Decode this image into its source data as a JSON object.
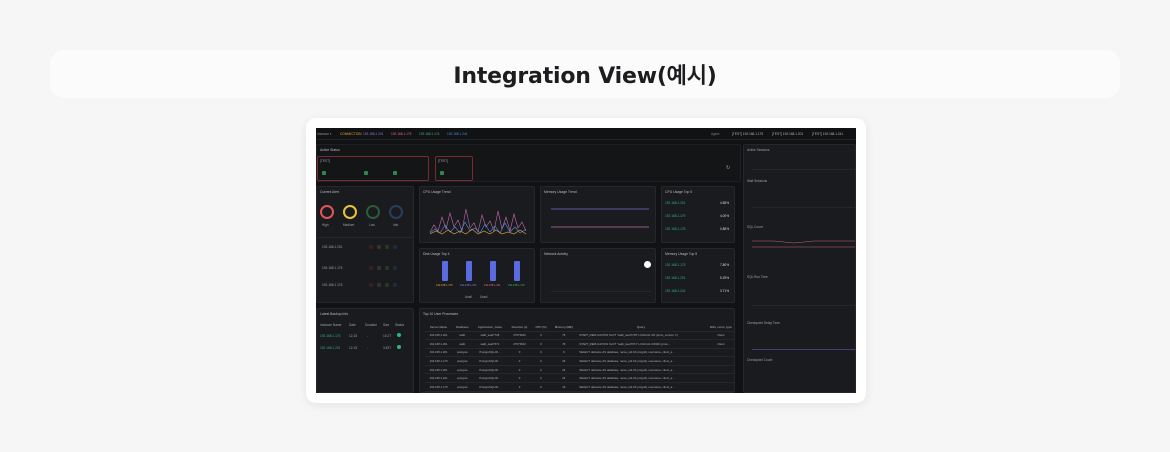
{
  "page": {
    "title": "Integration View(예시)"
  },
  "dash": {
    "topbar": {
      "instance_label": "Instance ▾",
      "tags": [
        "CONNECTION",
        "192.168.1.201",
        "192.168.1.175",
        "192.168.1.176",
        "192.168.1.241"
      ],
      "agent_label": "Agent",
      "agents": [
        "[TEST] 192.168.1.175",
        "[TEST] 192.168.1.201",
        "[TEST] 192.168.1.241"
      ],
      "colors": [
        "#e8a33b",
        "#8a7de0",
        "#e06a8a",
        "#45b36b",
        "#4a8fe0"
      ]
    },
    "active_status": {
      "title": "Active Status",
      "group_a": "[TEST]",
      "group_b": "[TEST]"
    },
    "alert": {
      "title": "Current Alert",
      "levels": [
        {
          "label": "High",
          "value": "1",
          "color": "#e05555"
        },
        {
          "label": "Medium",
          "value": "1",
          "color": "#e8c23b"
        },
        {
          "label": "Low",
          "value": "0",
          "color": "#3aa864"
        },
        {
          "label": "Info",
          "value": "0",
          "color": "#4a8fe0"
        }
      ],
      "hosts": [
        "192.168.1.201",
        "192.168.1.175",
        "192.168.1.176"
      ]
    },
    "cpu_trend": {
      "title": "CPU Usage Trend"
    },
    "mem_trend": {
      "title": "Memory Usage Trend"
    },
    "cpu_top": {
      "title": "CPU Usage Top 5",
      "rows": [
        {
          "host": "192.168.1.201",
          "value": "4.58%",
          "pct": 0.05
        },
        {
          "host": "192.168.1.175",
          "value": "4.00%",
          "pct": 0.04
        },
        {
          "host": "192.168.1.176",
          "value": "0.88%",
          "pct": 0.01
        }
      ]
    },
    "mem_top": {
      "title": "Memory Usage Top 5",
      "rows": [
        {
          "host": "192.168.1.175",
          "value": "7.80%",
          "pct": 0.08
        },
        {
          "host": "192.168.1.201",
          "value": "5.29%",
          "pct": 0.05
        },
        {
          "host": "192.168.1.241",
          "value": "3.71%",
          "pct": 0.04
        }
      ]
    },
    "disk_top": {
      "title": "Disk Usage Top 4",
      "hosts": [
        "192.168.1.175",
        "192.168.1.201",
        "192.168.1.241",
        "192.168.1.176"
      ],
      "legend": [
        "Avail",
        "Used"
      ]
    },
    "network": {
      "title": "Network Activity"
    },
    "backup": {
      "title": "Latest Backup Info",
      "headers": [
        "Instance Name",
        "Date",
        "Duration",
        "Size",
        "Status"
      ],
      "rows": [
        [
          "192.168.1.175",
          "12-15",
          "-",
          "15.2T"
        ],
        [
          "192.168.1.201",
          "12-15",
          "-",
          "3.52T"
        ]
      ]
    },
    "processes": {
      "title": "Top 10 User Processes",
      "headers": [
        "Server Name",
        "Database",
        "Application_name",
        "Duration (s)",
        "CPU (%)",
        "Memory (MB)",
        "Query",
        "Wait_event_type"
      ],
      "rows": [
        [
          "192.168.1.201",
          "walb",
          "walb_lead7728",
          "27673623",
          "0",
          "76",
          "START_REPLICATION SLOT \"walb_lead7728\" LOGICAL 0/0 (proto_version '1')",
          "Client"
        ],
        [
          "192.168.1.201",
          "walb",
          "walb_lead7671",
          "27673623",
          "0",
          "76",
          "START_REPLICATION SLOT \"walb_lead7671\" LOGICAL 0/4900 (proto...",
          "Client"
        ],
        [
          "192.168.1.201",
          "postgres",
          "PostgreSQLJD...",
          "0",
          "0",
          "0",
          "SELECT datname AS database, name, pid AS pro(pid), username, client_a...",
          ""
        ],
        [
          "192.168.1.175",
          "postgres",
          "PostgreSQLJD...",
          "0",
          "0",
          "26",
          "SELECT datname AS database, name, pid AS pro(pid), username, client_a...",
          ""
        ],
        [
          "192.168.1.201",
          "postgres",
          "PostgreSQLJD...",
          "0",
          "0",
          "24",
          "SELECT datname AS database, name, pid AS pro(pid), username, client_a...",
          ""
        ],
        [
          "192.168.1.241",
          "postgres",
          "PostgreSQLJD...",
          "0",
          "0",
          "24",
          "SELECT datname AS database, name, pid AS pro(pid), username, client_a...",
          ""
        ],
        [
          "192.168.1.175",
          "postgres",
          "PostgreSQLJD...",
          "0",
          "0",
          "16",
          "SELECT datname AS database, name, pid AS pro(pid), username, client_a...",
          ""
        ],
        [
          "192.168.1.201",
          "postgres",
          "PostgreSQLJD...",
          "0",
          "0",
          "16",
          "SELECT datname AS database, name, pid AS pro(pid), username, client_a...",
          ""
        ]
      ]
    },
    "right_column": {
      "charts": [
        "Active Sessions",
        "Wait Sessions",
        "SQL Count",
        "SQL Run Time",
        "Checkpoint Delay Time",
        "Checkpoint Count"
      ]
    }
  }
}
